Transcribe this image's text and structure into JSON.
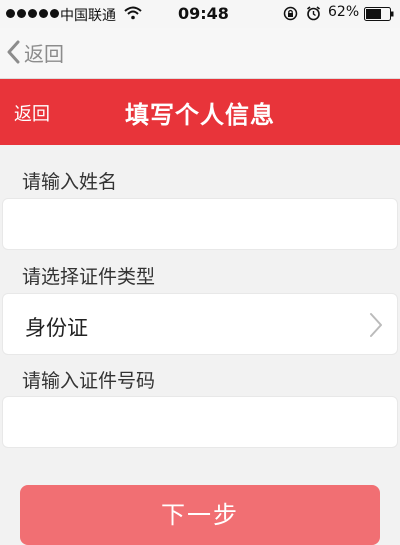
{
  "status_bar": {
    "carrier": "中国联通",
    "time": "09:48",
    "battery": "62%",
    "icons": [
      "signal-dots-icon",
      "wifi-icon",
      "rotation-lock-icon",
      "alarm-icon",
      "battery-icon"
    ]
  },
  "top_nav": {
    "back_label": "返回"
  },
  "header": {
    "back_label": "返回",
    "title": "填写个人信息",
    "color": "#e8343a"
  },
  "form": {
    "name_label": "请输入姓名",
    "name_value": "",
    "id_type_label": "请选择证件类型",
    "id_type_value": "身份证",
    "id_number_label": "请输入证件号码",
    "id_number_value": ""
  },
  "actions": {
    "next_label": "下一步",
    "next_color": "#f16f73"
  }
}
